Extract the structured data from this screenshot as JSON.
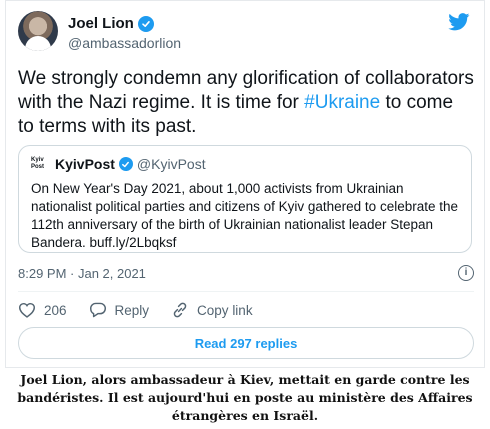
{
  "tweet": {
    "display_name": "Joel Lion",
    "handle": "@ambassadorlion",
    "text_before_hashtag": "We strongly condemn any glorification of collaborators with the Nazi regime. It is time for ",
    "hashtag": "#Ukraine",
    "text_after_hashtag": " to come to terms with its past.",
    "timestamp": "8:29 PM · Jan 2, 2021",
    "actions": {
      "like_count": "206",
      "reply_label": "Reply",
      "copy_link_label": "Copy link"
    },
    "read_replies_label": "Read 297 replies"
  },
  "quoted_tweet": {
    "logo_text": "Kyiv Post",
    "display_name": "KyivPost",
    "handle": "@KyivPost",
    "text": "On New Year's Day 2021, about 1,000 activists from Ukrainian nationalist political parties and citizens of Kyiv gathered to celebrate the 112th anniversary of the birth of Ukrainian nationalist leader Stepan Bandera. buff.ly/2Lbqksf"
  },
  "caption": {
    "text": "Joel Lion, alors ambassadeur à Kiev, mettait en garde contre les bandéristes. Il est aujourd'hui en poste au ministère des Affaires étrangères en Israël."
  },
  "colors": {
    "accent": "#1d9bf0",
    "text_primary": "#0f1419",
    "text_secondary": "#536471",
    "border": "#cfd9de"
  },
  "icons": [
    "verified-badge-icon",
    "twitter-bird-icon",
    "info-icon",
    "heart-icon",
    "reply-icon",
    "link-icon"
  ]
}
